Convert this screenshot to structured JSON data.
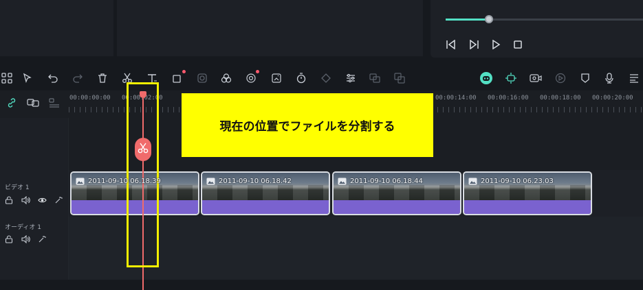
{
  "player": {
    "progress_percent": 22
  },
  "toolbar": {
    "icons": [
      "grid-icon",
      "pointer-icon",
      "undo-icon",
      "redo-icon",
      "delete-icon",
      "scissors-icon",
      "text-icon",
      "crop-icon",
      "mask-icon",
      "color-icon",
      "ai-color-icon",
      "auto-enhance-icon",
      "timer-icon",
      "keyframe-icon",
      "audio-adjust-icon",
      "speech-to-text-icon",
      "translate-icon"
    ],
    "right_icons": [
      "ai-avatar-icon",
      "ai-tracking-icon",
      "screen-record-icon",
      "auto-beat-icon",
      "marker-icon",
      "mic-icon",
      "storyboard-icon"
    ]
  },
  "ruler": {
    "labels": [
      "00:00:00:00",
      "00:00:02:00",
      "00:00:14:00",
      "00:00:16:00",
      "00:00:18:00",
      "00:00:20:00"
    ]
  },
  "tracks": {
    "video_name": "ビデオ 1",
    "audio_name": "オーディオ 1"
  },
  "clips": [
    {
      "title": "2011-09-10 06.18.39"
    },
    {
      "title": "2011-09-10 06.18.42"
    },
    {
      "title": "2011-09-10 06.18.44"
    },
    {
      "title": "2011-09-10 06.23.03"
    }
  ],
  "callout": {
    "text": "現在の位置でファイルを分割する"
  },
  "colors": {
    "accent": "#53e0c4",
    "playhead": "#f06b6b",
    "clip_bar": "#7a62cf",
    "callout_bg": "#ffff00",
    "highlight": "#f3ef00"
  }
}
